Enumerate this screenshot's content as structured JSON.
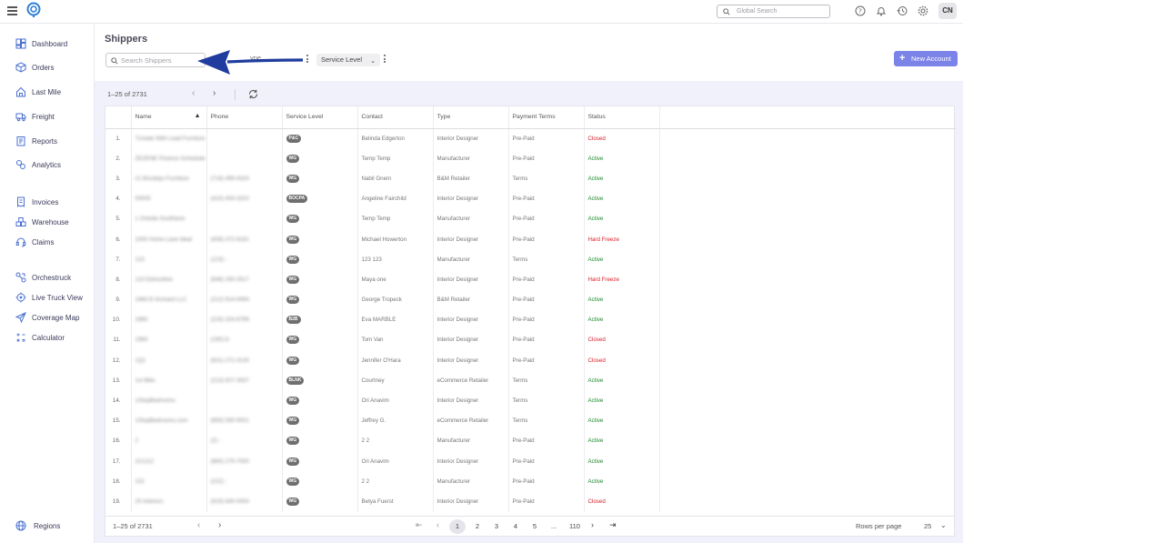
{
  "topbar": {
    "search_placeholder": "Global Search",
    "avatar_initials": "CN"
  },
  "sidebar": {
    "items": [
      {
        "label": "Dashboard",
        "icon": "dashboard-icon"
      },
      {
        "label": "Orders",
        "icon": "box-icon"
      },
      {
        "label": "Last Mile",
        "icon": "house-icon"
      },
      {
        "label": "Freight",
        "icon": "truck-icon"
      },
      {
        "label": "Reports",
        "icon": "report-icon"
      },
      {
        "label": "Analytics",
        "icon": "analytics-icon"
      },
      {
        "label": "Invoices",
        "icon": "invoice-icon"
      },
      {
        "label": "Warehouse",
        "icon": "warehouse-icon"
      },
      {
        "label": "Claims",
        "icon": "headset-icon"
      },
      {
        "label": "Orchestruck",
        "icon": "orchestruck-icon"
      },
      {
        "label": "Live Truck View",
        "icon": "target-icon"
      },
      {
        "label": "Coverage Map",
        "icon": "send-icon"
      },
      {
        "label": "Calculator",
        "icon": "calculator-icon"
      }
    ],
    "bottom_item": {
      "label": "Regions",
      "icon": "globe-icon"
    }
  },
  "page": {
    "title": "Shippers",
    "search_placeholder": "Search Shippers",
    "filter_partial": "ype",
    "service_level_filter": "Service Level",
    "new_account_label": "New Account",
    "count_label": "1–25 of 2731"
  },
  "table": {
    "columns": [
      "Name",
      "Phone",
      "Service Level",
      "Contact",
      "Type",
      "Payment Terms",
      "Status"
    ],
    "rows": [
      {
        "n": "1.",
        "name": "*Create With Lead Furniture",
        "phone": "",
        "level": "P&C",
        "contact": "Belinda Edgerton",
        "type": "Interior Designer",
        "terms": "Pre-Paid",
        "status": "Closed",
        "status_color": "red"
      },
      {
        "n": "2.",
        "name": "ZEZENE Finance Scheduler",
        "phone": "",
        "level": "WG",
        "contact": "Temp Temp",
        "type": "Manufacturer",
        "terms": "Pre-Paid",
        "status": "Active",
        "status_color": "green"
      },
      {
        "n": "3.",
        "name": "#1 Brooklyn Furniture",
        "phone": "(718) 499-4324",
        "level": "WG",
        "contact": "Nabil Gnem",
        "type": "B&M Retailer",
        "terms": "Terms",
        "status": "Active",
        "status_color": "green"
      },
      {
        "n": "4.",
        "name": "00000",
        "phone": "(410) 404-3310",
        "level": "BOCPA",
        "contact": "Angeline Fairchild",
        "type": "Interior Designer",
        "terms": "Pre-Paid",
        "status": "Active",
        "status_color": "green"
      },
      {
        "n": "5.",
        "name": "1 Oneida Southlane",
        "phone": "",
        "level": "WG",
        "contact": "Temp Temp",
        "type": "Manufacturer",
        "terms": "Pre-Paid",
        "status": "Active",
        "status_color": "green"
      },
      {
        "n": "6.",
        "name": "1000 Home Lane Ideal",
        "phone": "(408) 472-8181",
        "level": "WG",
        "contact": "Michael Howerton",
        "type": "Interior Designer",
        "terms": "Pre-Paid",
        "status": "Hard Freeze",
        "status_color": "red"
      },
      {
        "n": "7.",
        "name": "123",
        "phone": "(123) -",
        "level": "WG",
        "contact": "123 123",
        "type": "Manufacturer",
        "terms": "Terms",
        "status": "Active",
        "status_color": "green"
      },
      {
        "n": "8.",
        "name": "123 Edmonline",
        "phone": "(646) 250-2517",
        "level": "WG",
        "contact": "Maya one",
        "type": "Interior Designer",
        "terms": "Pre-Paid",
        "status": "Hard Freeze",
        "status_color": "red"
      },
      {
        "n": "9.",
        "name": "1666 B Orchard LLC",
        "phone": "(212) 914-9494",
        "level": "WG",
        "contact": "George Tropeck",
        "type": "B&M Retailer",
        "terms": "Pre-Paid",
        "status": "Active",
        "status_color": "green"
      },
      {
        "n": "10.",
        "name": "1960",
        "phone": "(225) 324-8799",
        "level": "B2B",
        "contact": "Eva MARBLE",
        "type": "Interior Designer",
        "terms": "Pre-Paid",
        "status": "Active",
        "status_color": "green"
      },
      {
        "n": "11.",
        "name": "1994",
        "phone": "(190) 6-",
        "level": "WG",
        "contact": "Tom Van",
        "type": "Interior Designer",
        "terms": "Pre-Paid",
        "status": "Closed",
        "status_color": "red"
      },
      {
        "n": "12.",
        "name": "1Q1",
        "phone": "(631) 271-3130",
        "level": "WG",
        "contact": "Jennifer O'Hara",
        "type": "Interior Designer",
        "terms": "Pre-Paid",
        "status": "Closed",
        "status_color": "red"
      },
      {
        "n": "13.",
        "name": "1st Bike",
        "phone": "(213) 627-3937",
        "level": "BLNK",
        "contact": "Courtney",
        "type": "eCommerce Retailer",
        "terms": "Terms",
        "status": "Active",
        "status_color": "green"
      },
      {
        "n": "14.",
        "name": "1StopBedrooms",
        "phone": "",
        "level": "WG",
        "contact": "Ori Anavim",
        "type": "Interior Designer",
        "terms": "Terms",
        "status": "Active",
        "status_color": "green"
      },
      {
        "n": "15.",
        "name": "1StopBedrooms.com",
        "phone": "(855) 590-9001",
        "level": "WG",
        "contact": "Jeffrey G.",
        "type": "eCommerce Retailer",
        "terms": "Terms",
        "status": "Active",
        "status_color": "green"
      },
      {
        "n": "16.",
        "name": "2",
        "phone": "(2) -",
        "level": "WG",
        "contact": "2 2",
        "type": "Manufacturer",
        "terms": "Pre-Paid",
        "status": "Active",
        "status_color": "green"
      },
      {
        "n": "17.",
        "name": "221212",
        "phone": "(860) 279-7000",
        "level": "WG",
        "contact": "Ori Anavim",
        "type": "Interior Designer",
        "terms": "Pre-Paid",
        "status": "Active",
        "status_color": "green"
      },
      {
        "n": "18.",
        "name": "222",
        "phone": "(222) -",
        "level": "WG",
        "contact": "2 2",
        "type": "Manufacturer",
        "terms": "Pre-Paid",
        "status": "Active",
        "status_color": "green"
      },
      {
        "n": "19.",
        "name": "25 Interiors",
        "phone": "(919) 640-0004",
        "level": "WG",
        "contact": "Betya Fuerst",
        "type": "Interior Designer",
        "terms": "Pre-Paid",
        "status": "Closed",
        "status_color": "red"
      }
    ]
  },
  "footer": {
    "count_label": "1–25 of 2731",
    "pages": [
      "1",
      "2",
      "3",
      "4",
      "5",
      "...",
      "110"
    ],
    "current_page": "1",
    "rows_per_page_label": "Rows per page",
    "rows_per_page_value": "25"
  },
  "colors": {
    "accent": "#7b83e8",
    "active_status": "#1e8a2e",
    "closed_status": "#d8222a",
    "arrow": "#1f3c9e"
  }
}
